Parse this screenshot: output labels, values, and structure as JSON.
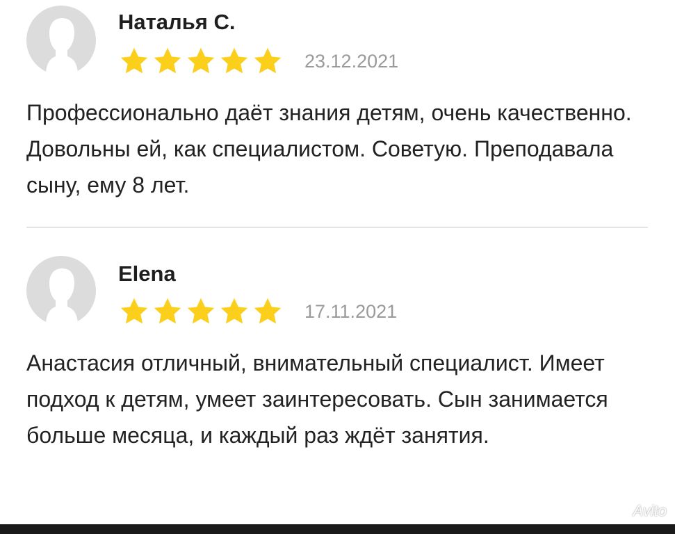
{
  "reviews": [
    {
      "author": "Наталья С.",
      "rating": 5,
      "date": "23.12.2021",
      "text": "Профессионально даёт знания детям, очень качественно. Довольны ей, как специалистом. Советую. Преподавала сыну, ему 8 лет."
    },
    {
      "author": "Elena",
      "rating": 5,
      "date": "17.11.2021",
      "text": "Анастасия отличный, внимательный специалист. Имеет подход к детям, умеет заинтересовать. Сын занимается больше месяца, и каждый раз ждёт занятия."
    }
  ],
  "watermark": "Avito",
  "colors": {
    "star": "#fbcf1c",
    "avatar_bg": "#dcdcdc",
    "avatar_fg": "#ffffff",
    "date": "#9a9a9a"
  },
  "icons": {
    "avatar": "user-silhouette-icon",
    "star": "star-icon"
  }
}
